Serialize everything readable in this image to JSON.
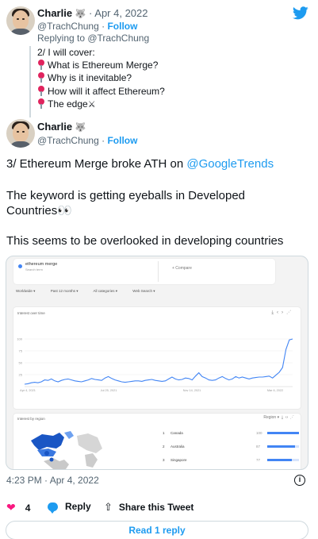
{
  "colors": {
    "accent": "#1d9bf0",
    "like": "#f91880",
    "trend_line": "#4285f4"
  },
  "logo": {
    "icon": "twitter-bird-icon"
  },
  "quoted_tweet": {
    "name": "Charlie",
    "badge_icon": "wolf-emoji-icon",
    "separator": "·",
    "date": "Apr 4, 2022",
    "handle": "@TrachChung",
    "follow": "Follow",
    "replying_to": "Replying to @TrachChung",
    "lines": [
      {
        "icon": "pin-icon",
        "text": "2/ I will cover:"
      },
      {
        "icon": "pin-icon",
        "text": "What is Ethereum Merge?"
      },
      {
        "icon": "pin-icon",
        "text": "Why is it inevitable?"
      },
      {
        "icon": "pin-icon",
        "text": "How will it affect Ethereum?"
      },
      {
        "icon": "pin-icon",
        "text": "The edge"
      }
    ],
    "edge_icon": "crossed-swords-icon"
  },
  "main_tweet": {
    "name": "Charlie",
    "badge_icon": "wolf-emoji-icon",
    "handle": "@TrachChung",
    "separator": "·",
    "follow": "Follow",
    "line1_prefix": "3/ Ethereum Merge broke ATH on ",
    "line1_mention": "@GoogleTrends",
    "line2": "The keyword is getting eyeballs in Developed",
    "line3": "Countries👀",
    "line4": "This seems to be overlooked in developing countries"
  },
  "trends_image": {
    "term": "ethereum merge",
    "term_sub": "Search term",
    "compare": "+ Compare",
    "filters": [
      "Worldwide ▾",
      "Past 12 months ▾",
      "All categories ▾",
      "Web Search ▾"
    ],
    "interest_title": "Interest over time",
    "region_title": "Interest by region",
    "region_ctrl": "Region ▾",
    "chart_data": {
      "type": "line",
      "title": "Interest over time",
      "x_ticks": [
        "Apr 4, 2021",
        "Jul 25, 2021",
        "Nov 14, 2021",
        "Mar 6, 2022"
      ],
      "y_ticks": [
        100,
        75,
        50,
        25
      ],
      "ylim": [
        0,
        100
      ],
      "values": [
        5,
        6,
        8,
        9,
        8,
        10,
        14,
        13,
        16,
        12,
        10,
        13,
        15,
        16,
        14,
        12,
        11,
        10,
        12,
        14,
        17,
        15,
        14,
        13,
        18,
        21,
        17,
        14,
        12,
        10,
        9,
        10,
        11,
        12,
        12,
        11,
        13,
        14,
        15,
        13,
        12,
        11,
        12,
        16,
        20,
        16,
        14,
        15,
        18,
        17,
        14,
        22,
        29,
        21,
        18,
        14,
        13,
        14,
        18,
        21,
        17,
        14,
        16,
        21,
        18,
        20,
        18,
        16,
        18,
        19,
        20,
        20,
        21,
        22,
        18,
        24,
        30,
        40,
        78,
        98,
        100
      ]
    },
    "regions": [
      {
        "rank": "1",
        "name": "Canada",
        "value": "100",
        "share": 1.0
      },
      {
        "rank": "2",
        "name": "Australia",
        "value": "87",
        "share": 0.87
      },
      {
        "rank": "3",
        "name": "Singapore",
        "value": "77",
        "share": 0.77
      }
    ]
  },
  "meta": {
    "timestamp": "4:23 PM · Apr 4, 2022",
    "likes": "4",
    "reply_label": "Reply",
    "share_label": "Share this Tweet",
    "read_replies": "Read 1 reply"
  }
}
